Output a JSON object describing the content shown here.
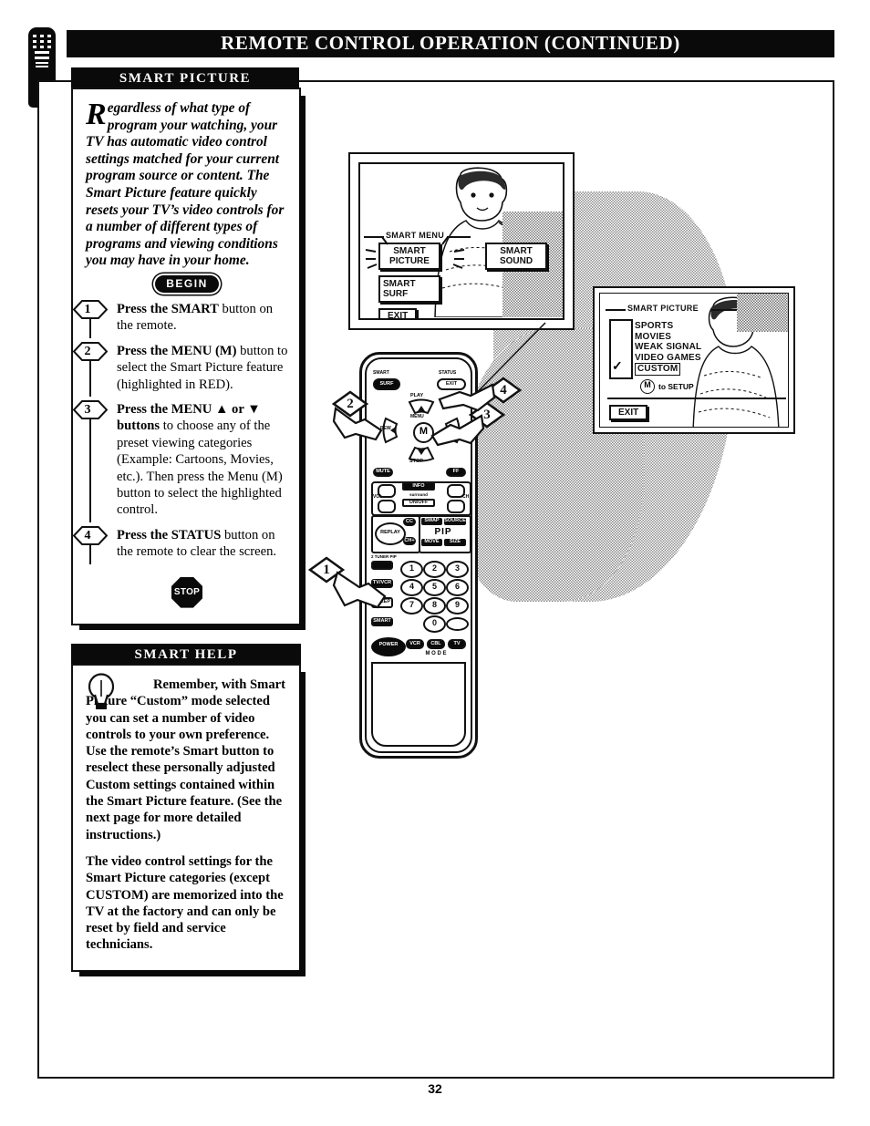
{
  "header": {
    "title": "REMOTE CONTROL OPERATION (CONTINUED)",
    "tab_icon": "remote-control-icon"
  },
  "sections": {
    "smart_picture": {
      "heading": "SMART PICTURE",
      "intro_dropcap": "R",
      "intro": "egardless of what type of program your watching, your TV has automatic video control settings matched for your current program source or content. The Smart Picture feature quickly resets your TV’s video controls for a number of different types of programs and viewing conditions you may have in your home.",
      "begin_label": "BEGIN",
      "stop_label": "STOP",
      "steps": [
        {
          "number": "1",
          "bold": "Press the SMART",
          "rest": " button on the remote."
        },
        {
          "number": "2",
          "bold": "Press the MENU (M)",
          "rest": " button to select the Smart Picture feature (highlighted in RED)."
        },
        {
          "number": "3",
          "bold": "Press the MENU ▲ or ▼ buttons",
          "rest": " to choose any of the preset viewing categories (Example: Cartoons, Movies, etc.). Then press the Menu (M) button to select the highlighted control."
        },
        {
          "number": "4",
          "bold": "Press the STATUS",
          "rest": " button on the remote to clear the screen."
        }
      ]
    },
    "smart_help": {
      "heading": "SMART HELP",
      "icon": "lightbulb-icon",
      "paragraphs": [
        "Remember, with Smart Picture “Custom” mode selected you can set a number of video controls to your own preference. Use the remote’s Smart button to reselect these personally adjusted Custom settings contained within the Smart Picture feature. (See the next page for more detailed instructions.)",
        "The video control settings for the Smart Picture categories (except CUSTOM) are memorized into the TV at the factory and can only be reset by field and service technicians."
      ]
    }
  },
  "figure": {
    "tv_screen_1": {
      "menu_title": "SMART MENU",
      "buttons": [
        "SMART PICTURE",
        "SMART SURF",
        "SMART SOUND"
      ],
      "smart_picture_line1": "SMART",
      "smart_picture_line2": "PICTURE",
      "smart_surf_line1": "SMART",
      "smart_surf_line2": "SURF",
      "smart_sound_line1": "SMART",
      "smart_sound_line2": "SOUND",
      "exit_label": "EXIT"
    },
    "tv_screen_2": {
      "menu_title": "SMART PICTURE",
      "items": [
        "SPORTS",
        "MOVIES",
        "WEAK SIGNAL",
        "VIDEO GAMES",
        "CUSTOM"
      ],
      "selected_item": "CUSTOM",
      "check_mark": "✓",
      "setup_hint_button": "M",
      "setup_hint": "to SETUP",
      "exit_label": "EXIT"
    },
    "remote": {
      "callouts": [
        "1",
        "2",
        "3",
        "4"
      ],
      "top_left_button_line1": "SMART",
      "top_left_button_line2": "SURF",
      "top_right_button_line1": "STATUS",
      "top_right_button_line2": "EXIT",
      "nav_center": "M",
      "nav_menu": "MENU",
      "nav_play": "PLAY",
      "nav_stop": "STOP",
      "nav_rew": "REW",
      "nav_ff": "FF",
      "mute_label": "MUTE",
      "info_label": "INFO",
      "vol_label": "VOL",
      "ch_label": "CH",
      "smart_label": "SMART",
      "surround_label": "surround",
      "onoff_label": "ON/OFF",
      "replay_label": "REPLAY",
      "cc_label": "CC",
      "ch_plus": "CH+",
      "ch_minus": "CH-",
      "pip_label": "PIP",
      "pip_swap": "SWAP",
      "pip_source": "SOURCE",
      "pip_move": "MOVE",
      "pip_size": "SIZE",
      "two_tuner_label": "2 TUNER PIP",
      "tv_vcr_label": "TV/VCR",
      "sleep_label": "SLEEP",
      "smart_btn_label": "SMART",
      "power_label": "POWER",
      "mode_label": "M  O  D  E",
      "mode_buttons": [
        "VCR",
        "CBL",
        "TV"
      ],
      "keypad": [
        "1",
        "2",
        "3",
        "4",
        "5",
        "6",
        "7",
        "8",
        "9",
        "0"
      ]
    }
  },
  "footer": {
    "page_number": "32"
  }
}
